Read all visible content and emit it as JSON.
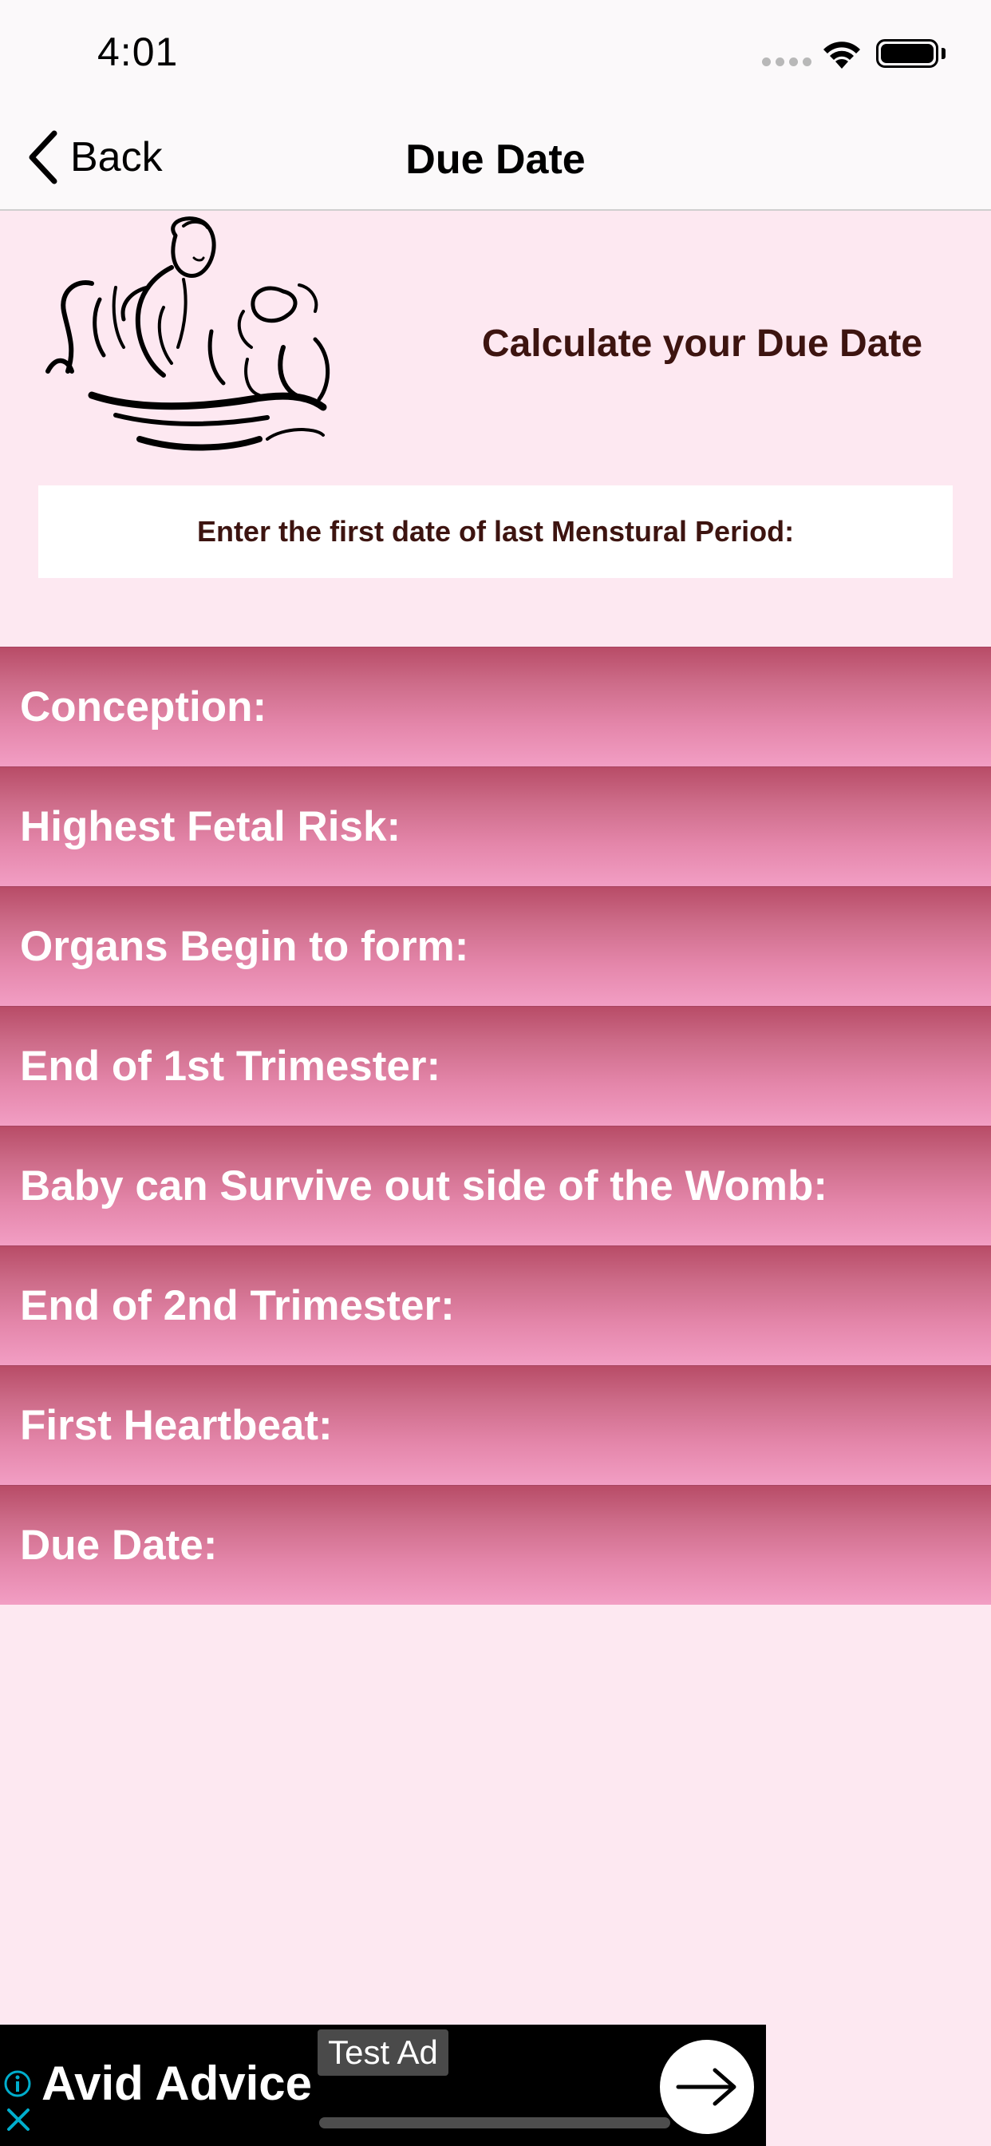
{
  "status": {
    "time": "4:01"
  },
  "nav": {
    "back_label": "Back",
    "title": "Due Date"
  },
  "header": {
    "title": "Calculate your Due Date"
  },
  "lmp_prompt": "Enter the first date of last Menstural Period:",
  "rows": [
    {
      "label": "Conception:"
    },
    {
      "label": "Highest Fetal Risk:"
    },
    {
      "label": "Organs Begin to form:"
    },
    {
      "label": "End of 1st Trimester:"
    },
    {
      "label": "Baby can Survive out side of the Womb:"
    },
    {
      "label": "End of 2nd Trimester:"
    },
    {
      "label": "First Heartbeat:"
    },
    {
      "label": "Due Date:"
    }
  ],
  "ad": {
    "title": "Avid Advice",
    "label": "Test Ad"
  },
  "colors": {
    "background": "#fde8f1",
    "row_top": "#b84c67",
    "row_bottom": "#f29ec4",
    "title_text": "#3d1410"
  }
}
